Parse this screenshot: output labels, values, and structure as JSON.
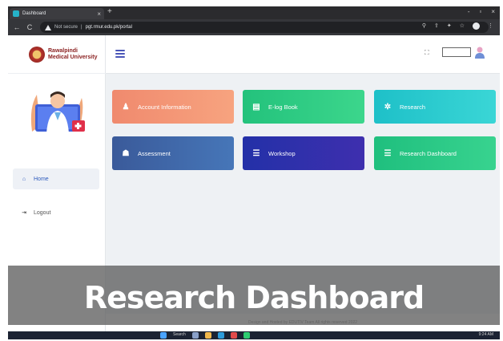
{
  "browser": {
    "tab_title": "Dashboard",
    "new_tab": "+",
    "tab_close": "×",
    "back": "←",
    "reload": "C",
    "security_label": "Not secure",
    "url": "pgt.rmur.edu.pk/portal",
    "win_minimize": "-",
    "win_restore": "▫",
    "win_close": "×"
  },
  "sidebar": {
    "brand_name": "Rawalpindi Medical University",
    "nav": [
      {
        "label": "Home",
        "icon": "home-icon"
      },
      {
        "label": "Logout",
        "icon": "logout-icon"
      }
    ]
  },
  "cards": [
    {
      "label": "Account Information",
      "icon": "user-icon",
      "color": "#f08a6e"
    },
    {
      "label": "E-log Book",
      "icon": "book-icon",
      "color": "#23c27c"
    },
    {
      "label": "Research",
      "icon": "gear-icon",
      "color": "#1ec0c8"
    },
    {
      "label": "Assessment",
      "icon": "award-icon",
      "color": "#3a5a9a"
    },
    {
      "label": "Workshop",
      "icon": "list-icon",
      "color": "#2330a8"
    },
    {
      "label": "Research Dashboard",
      "icon": "list-icon",
      "color": "#1fbf7e"
    }
  ],
  "footer": {
    "text": "Design and Hosted by EDUTIV Team All rights reserved 2022"
  },
  "taskbar": {
    "search": "Search",
    "time": "9:24 AM"
  },
  "caption": "Research Dashboard"
}
